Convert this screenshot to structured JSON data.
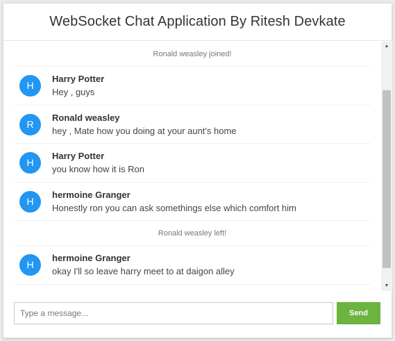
{
  "header": {
    "title": "WebSocket Chat Application By Ritesh Devkate"
  },
  "messages": [
    {
      "type": "event",
      "text": "Ronald weasley joined!"
    },
    {
      "type": "chat",
      "avatar_letter": "H",
      "avatar_color": "#2196f3",
      "sender": "Harry Potter",
      "text": "Hey , guys"
    },
    {
      "type": "chat",
      "avatar_letter": "R",
      "avatar_color": "#2196f3",
      "sender": "Ronald weasley",
      "text": "hey , Mate how you doing at your aunt's home"
    },
    {
      "type": "chat",
      "avatar_letter": "H",
      "avatar_color": "#2196f3",
      "sender": "Harry Potter",
      "text": "you know how it is Ron"
    },
    {
      "type": "chat",
      "avatar_letter": "H",
      "avatar_color": "#2196f3",
      "sender": "hermoine Granger",
      "text": "Honestly ron you can ask somethings else which comfort him"
    },
    {
      "type": "event",
      "text": "Ronald weasley left!"
    },
    {
      "type": "chat",
      "avatar_letter": "H",
      "avatar_color": "#2196f3",
      "sender": "hermoine Granger",
      "text": "okay I'll so leave harry meet to at daigon alley"
    }
  ],
  "input": {
    "placeholder": "Type a message...",
    "value": ""
  },
  "send_button": {
    "label": "Send",
    "color": "#6db33f"
  },
  "colors": {
    "accent": "#2196f3",
    "send": "#6db33f"
  },
  "icons": {
    "scroll_up": "triangle-up-icon",
    "scroll_down": "triangle-down-icon"
  }
}
